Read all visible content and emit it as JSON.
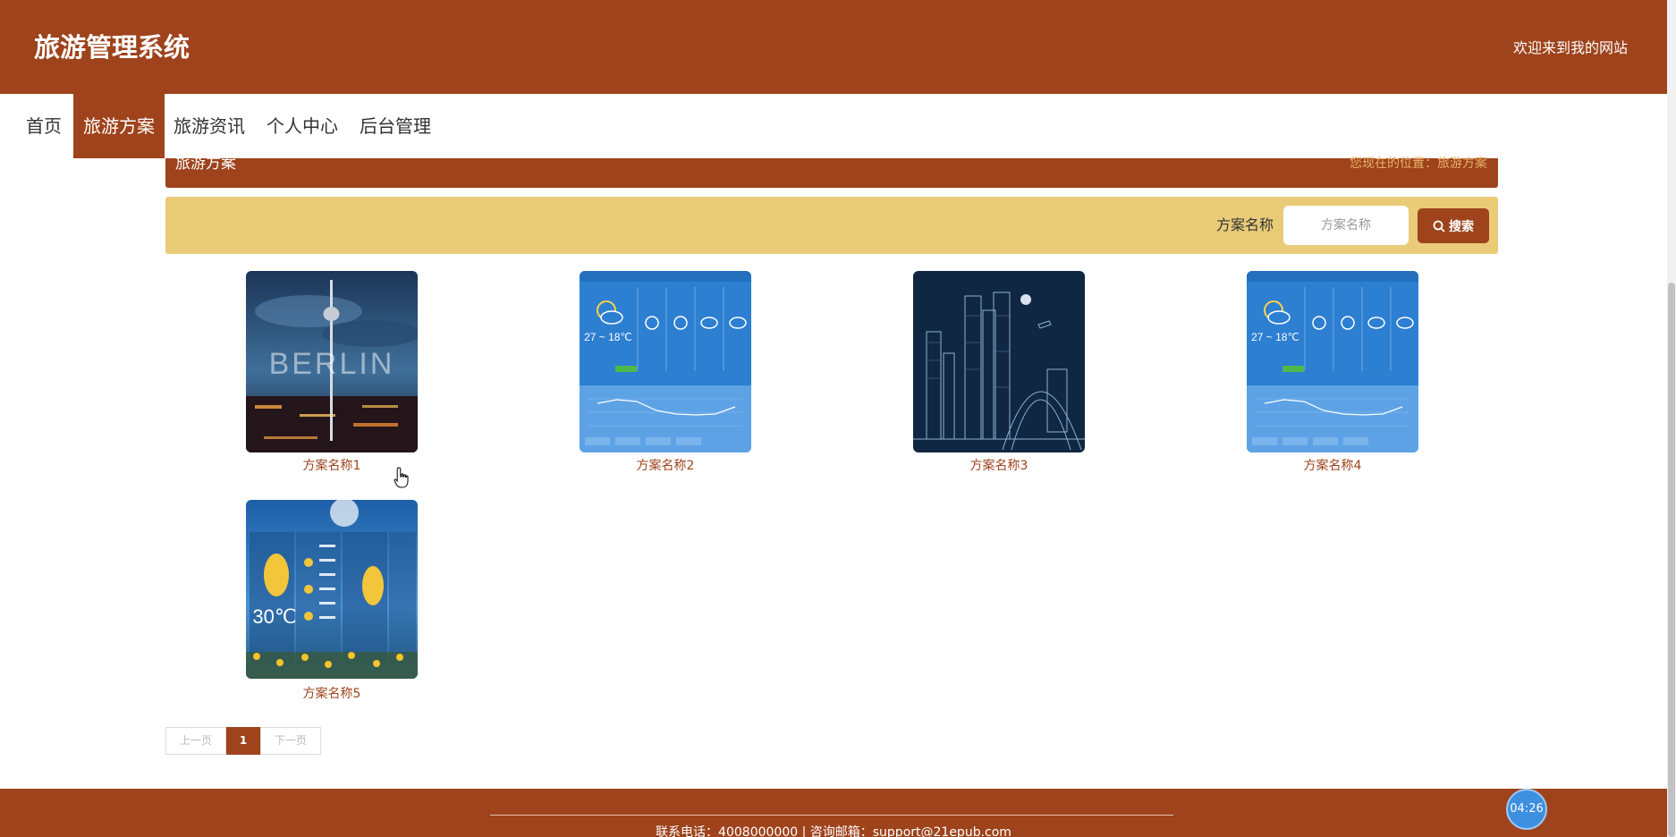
{
  "header": {
    "title": "旅游管理系统",
    "welcome": "欢迎来到我的网站"
  },
  "nav": {
    "items": [
      "首页",
      "旅游方案",
      "旅游资讯",
      "个人中心",
      "后台管理"
    ],
    "active_index": 1
  },
  "section": {
    "title": "旅游方案",
    "breadcrumb": "您现在的位置：旅游方案"
  },
  "search": {
    "label": "方案名称",
    "placeholder": "方案名称",
    "value": "",
    "button_label": "搜索"
  },
  "plans": [
    {
      "name": "方案名称1",
      "image": "berlin-tv-tower-photo"
    },
    {
      "name": "方案名称2",
      "image": "weather-forecast-screenshot"
    },
    {
      "name": "方案名称3",
      "image": "city-line-art-illustration"
    },
    {
      "name": "方案名称4",
      "image": "weather-forecast-screenshot"
    },
    {
      "name": "方案名称5",
      "image": "weather-app-screenshot"
    }
  ],
  "pagination": {
    "prev": "上一页",
    "current": "1",
    "next": "下一页"
  },
  "footer": {
    "contact": "联系电话：4008000000 | 咨询邮箱：support@21epub.com"
  },
  "clock": {
    "time": "04:26"
  },
  "colors": {
    "brand": "#9e431c",
    "search_bg": "#e9cb78",
    "breadcrumb": "#e8b36a"
  }
}
